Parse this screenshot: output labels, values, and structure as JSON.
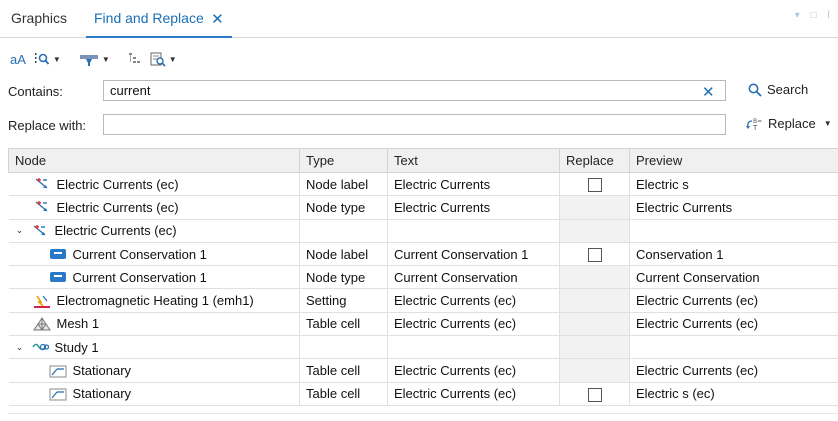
{
  "tabs": [
    {
      "label": "Graphics"
    },
    {
      "label": "Find and Replace",
      "close": "✕"
    }
  ],
  "toolbar": {
    "match_case": "aA"
  },
  "contains": {
    "label": "Contains:",
    "value": "current",
    "clear": "✕"
  },
  "replace_with": {
    "label": "Replace with:",
    "value": ""
  },
  "buttons": {
    "search": "Search",
    "replace": "Replace"
  },
  "table": {
    "headers": [
      "Node",
      "Type",
      "Text",
      "Replace",
      "Preview"
    ],
    "rows": [
      {
        "indent": 1,
        "chevron": "",
        "icon": "electric-currents-icon",
        "node": "Electric Currents (ec)",
        "type": "Node label",
        "text": "Electric Currents",
        "replace": "checkbox",
        "preview": "Electric s"
      },
      {
        "indent": 1,
        "chevron": "",
        "icon": "electric-currents-icon",
        "node": "Electric Currents (ec)",
        "type": "Node type",
        "text": "Electric Currents",
        "replace": "none",
        "preview": "Electric Currents"
      },
      {
        "indent": 0,
        "chevron": "⌄",
        "icon": "electric-currents-icon",
        "node": "Electric Currents (ec)",
        "type": "",
        "text": "",
        "replace": "none",
        "preview": ""
      },
      {
        "indent": 2,
        "chevron": "",
        "icon": "current-conservation-icon",
        "node": "Current Conservation 1",
        "type": "Node label",
        "text": "Current Conservation 1",
        "replace": "checkbox",
        "preview": " Conservation 1"
      },
      {
        "indent": 2,
        "chevron": "",
        "icon": "current-conservation-icon",
        "node": "Current Conservation 1",
        "type": "Node type",
        "text": "Current Conservation",
        "replace": "none",
        "preview": "Current Conservation"
      },
      {
        "indent": 1,
        "chevron": "",
        "icon": "electromagnetic-heating-icon",
        "node": "Electromagnetic Heating 1 (emh1)",
        "type": "Setting",
        "text": "Electric Currents (ec)",
        "replace": "none",
        "preview": "Electric Currents (ec)"
      },
      {
        "indent": 1,
        "chevron": "",
        "icon": "mesh-icon",
        "node": "Mesh 1",
        "type": "Table cell",
        "text": "Electric Currents (ec)",
        "replace": "none",
        "preview": "Electric Currents (ec)"
      },
      {
        "indent": 0,
        "chevron": "⌄",
        "icon": "study-icon",
        "node": "Study 1",
        "type": "",
        "text": "",
        "replace": "none",
        "preview": ""
      },
      {
        "indent": 2,
        "chevron": "",
        "icon": "stationary-icon",
        "node": "Stationary",
        "type": "Table cell",
        "text": "Electric Currents (ec)",
        "replace": "none",
        "preview": "Electric Currents (ec)"
      },
      {
        "indent": 2,
        "chevron": "",
        "icon": "stationary-icon",
        "node": "Stationary",
        "type": "Table cell",
        "text": "Electric Currents (ec)",
        "replace": "checkbox",
        "preview": "Electric s (ec)"
      }
    ]
  }
}
